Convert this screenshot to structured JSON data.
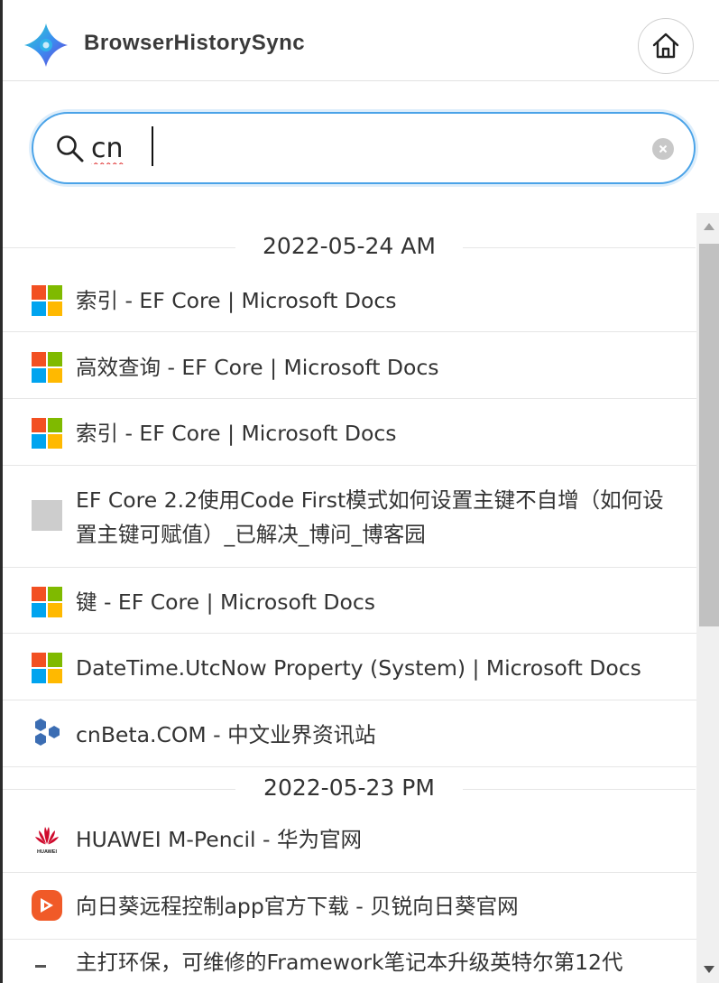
{
  "app": {
    "title": "BrowserHistorySync"
  },
  "header": {
    "home_icon": "home-icon",
    "logo_icon": "sparkle-logo"
  },
  "search": {
    "value": "cn",
    "placeholder": "",
    "search_icon": "search-icon",
    "clear_icon": "clear-icon"
  },
  "groups": [
    {
      "date": "2022-05-24 AM",
      "items": [
        {
          "title": "索引 - EF Core | Microsoft Docs",
          "favicon": "microsoft"
        },
        {
          "title": "高效查询 - EF Core | Microsoft Docs",
          "favicon": "microsoft"
        },
        {
          "title": "索引 - EF Core | Microsoft Docs",
          "favicon": "microsoft"
        },
        {
          "title": "EF Core 2.2使用Code First模式如何设置主键不自增（如何设置主键可赋值）_已解决_博问_博客园",
          "favicon": "blank"
        },
        {
          "title": "键 - EF Core | Microsoft Docs",
          "favicon": "microsoft"
        },
        {
          "title": "DateTime.UtcNow Property (System) | Microsoft Docs",
          "favicon": "microsoft"
        },
        {
          "title": "cnBeta.COM - 中文业界资讯站",
          "favicon": "cnbeta"
        }
      ]
    },
    {
      "date": "2022-05-23 PM",
      "items": [
        {
          "title": "HUAWEI M-Pencil - 华为官网",
          "favicon": "huawei"
        },
        {
          "title": "向日葵远程控制app官方下载 - 贝锐向日葵官网",
          "favicon": "sunlogin"
        },
        {
          "title": "主打环保，可维修的Framework笔记本升级英特尔第12代",
          "favicon": "blank"
        }
      ]
    }
  ],
  "colors": {
    "accent": "#4aa3e8",
    "ms_red": "#f25022",
    "ms_green": "#7fba00",
    "ms_blue": "#00a4ef",
    "ms_yellow": "#ffb900",
    "huawei_red": "#cf0a2c",
    "sunlogin_orange": "#f05a28",
    "cnbeta_blue": "#3b6db3"
  }
}
